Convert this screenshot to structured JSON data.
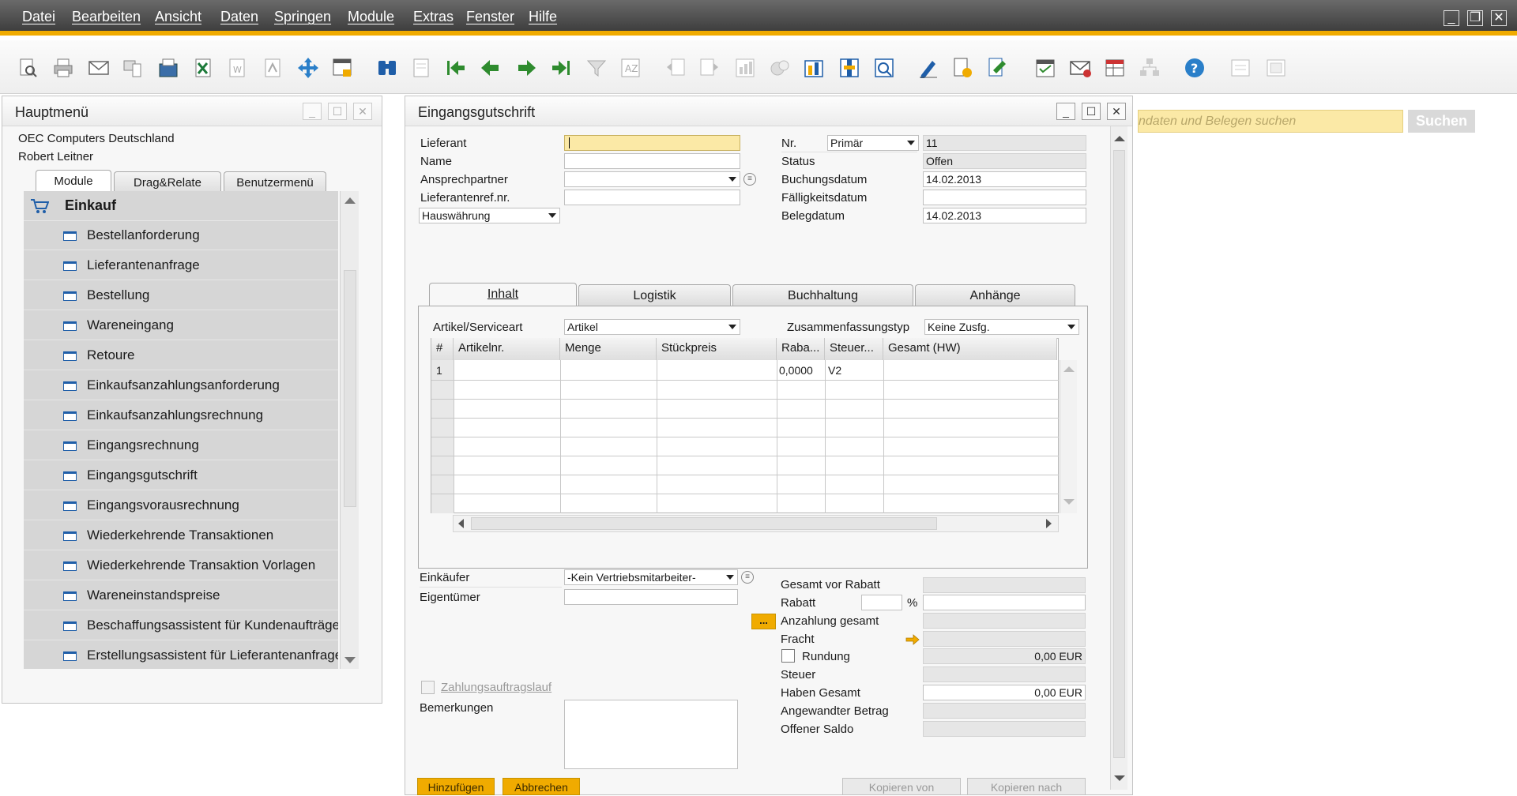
{
  "menubar": {
    "items": [
      "Datei",
      "Bearbeiten",
      "Ansicht",
      "Daten",
      "Springen",
      "Module",
      "Extras",
      "Fenster",
      "Hilfe"
    ]
  },
  "toolbar": {
    "icons": [
      "preview-icon",
      "print-icon",
      "email-icon",
      "sms-icon",
      "fax-icon",
      "excel-icon",
      "word-icon",
      "pdf-icon",
      "move-icon",
      "lock-icon",
      "find-icon",
      "add-icon",
      "first-record-icon",
      "previous-record-icon",
      "next-record-icon",
      "last-record-icon",
      "filter-icon",
      "sort-icon",
      "base-document-icon",
      "target-document-icon",
      "gross-profit-icon",
      "print-layout-icon",
      "settings-icon",
      "document-drafts-icon",
      "query-icon",
      "journal-icon",
      "edit-icon",
      "new-document-icon",
      "approve-icon",
      "calendar-icon",
      "messages-icon",
      "pivot-icon",
      "org-chart-icon",
      "help-icon",
      "form-settings-icon",
      "layout-icon"
    ]
  },
  "search": {
    "placeholder": "ndaten und Belegen suchen",
    "button": "Suchen"
  },
  "main_menu": {
    "title": "Hauptmenü",
    "company": "OEC Computers Deutschland",
    "user": "Robert Leitner",
    "tabs": [
      "Module",
      "Drag&Relate",
      "Benutzermenü"
    ],
    "category": "Einkauf",
    "items": [
      "Bestellanforderung",
      "Lieferantenanfrage",
      "Bestellung",
      "Wareneingang",
      "Retoure",
      "Einkaufsanzahlungsanforderung",
      "Einkaufsanzahlungsrechnung",
      "Eingangsrechnung",
      "Eingangsgutschrift",
      "Eingangsvorausrechnung",
      "Wiederkehrende Transaktionen",
      "Wiederkehrende Transaktion Vorlagen",
      "Wareneinstandspreise",
      "Beschaffungsassistent für Kundenaufträge",
      "Erstellungsassistent für Lieferantenanfragen"
    ]
  },
  "form": {
    "title": "Eingangsgutschrift",
    "header_left": {
      "lieferant": {
        "label": "Lieferant",
        "value": ""
      },
      "name": {
        "label": "Name",
        "value": ""
      },
      "ansprechpartner": {
        "label": "Ansprechpartner",
        "value": ""
      },
      "lieferantenref": {
        "label": "Lieferantenref.nr.",
        "value": ""
      },
      "waehrung": "Hauswährung"
    },
    "header_right": {
      "nr": {
        "label": "Nr.",
        "series": "Primär",
        "value": "11"
      },
      "status": {
        "label": "Status",
        "value": "Offen"
      },
      "buchungsdatum": {
        "label": "Buchungsdatum",
        "value": "14.02.2013"
      },
      "faelligkeitsdatum": {
        "label": "Fälligkeitsdatum",
        "value": ""
      },
      "belegdatum": {
        "label": "Belegdatum",
        "value": "14.02.2013"
      }
    },
    "tabs": [
      "Inhalt",
      "Logistik",
      "Buchhaltung",
      "Anhänge"
    ],
    "content": {
      "artikel_label": "Artikel/Serviceart",
      "artikel_value": "Artikel",
      "zusammenfassung_label": "Zusammenfassungstyp",
      "zusammenfassung_value": "Keine Zusfg.",
      "columns": [
        "#",
        "Artikelnr.",
        "Menge",
        "Stückpreis",
        "Raba...",
        "Steuer...",
        "Gesamt (HW)"
      ],
      "rows": [
        {
          "num": "1",
          "artikelnr": "",
          "menge": "",
          "stueckpreis": "",
          "rabatt": "0,0000",
          "steuer": "V2",
          "gesamt": ""
        }
      ]
    },
    "footer_left": {
      "einkaeufer": {
        "label": "Einkäufer",
        "value": "-Kein Vertriebsmitarbeiter-"
      },
      "eigentuemer": {
        "label": "Eigentümer",
        "value": ""
      },
      "zahlungsauftragslauf": "Zahlungsauftragslauf",
      "bemerkungen": "Bemerkungen"
    },
    "totals": {
      "gesamt_vor_rabatt": {
        "label": "Gesamt vor Rabatt",
        "value": ""
      },
      "rabatt": {
        "label": "Rabatt",
        "percent_sign": "%",
        "value": ""
      },
      "anzahlung": {
        "label": "Anzahlung gesamt",
        "button": "...",
        "value": ""
      },
      "fracht": {
        "label": "Fracht",
        "value": ""
      },
      "rundung": {
        "label": "Rundung",
        "value": "0,00 EUR"
      },
      "steuer": {
        "label": "Steuer",
        "value": ""
      },
      "haben_gesamt": {
        "label": "Haben Gesamt",
        "value": "0,00 EUR"
      },
      "angewandter_betrag": {
        "label": "Angewandter Betrag",
        "value": ""
      },
      "offener_saldo": {
        "label": "Offener Saldo",
        "value": ""
      }
    },
    "buttons": {
      "add": "Hinzufügen",
      "cancel": "Abbrechen",
      "copy_from": "Kopieren von",
      "copy_to": "Kopieren nach"
    }
  },
  "colors": {
    "accent": "#f0ab00",
    "menubar": "#4a4a4a",
    "icon_blue": "#1f5ea8",
    "highlight_field": "#fbe9a6"
  }
}
